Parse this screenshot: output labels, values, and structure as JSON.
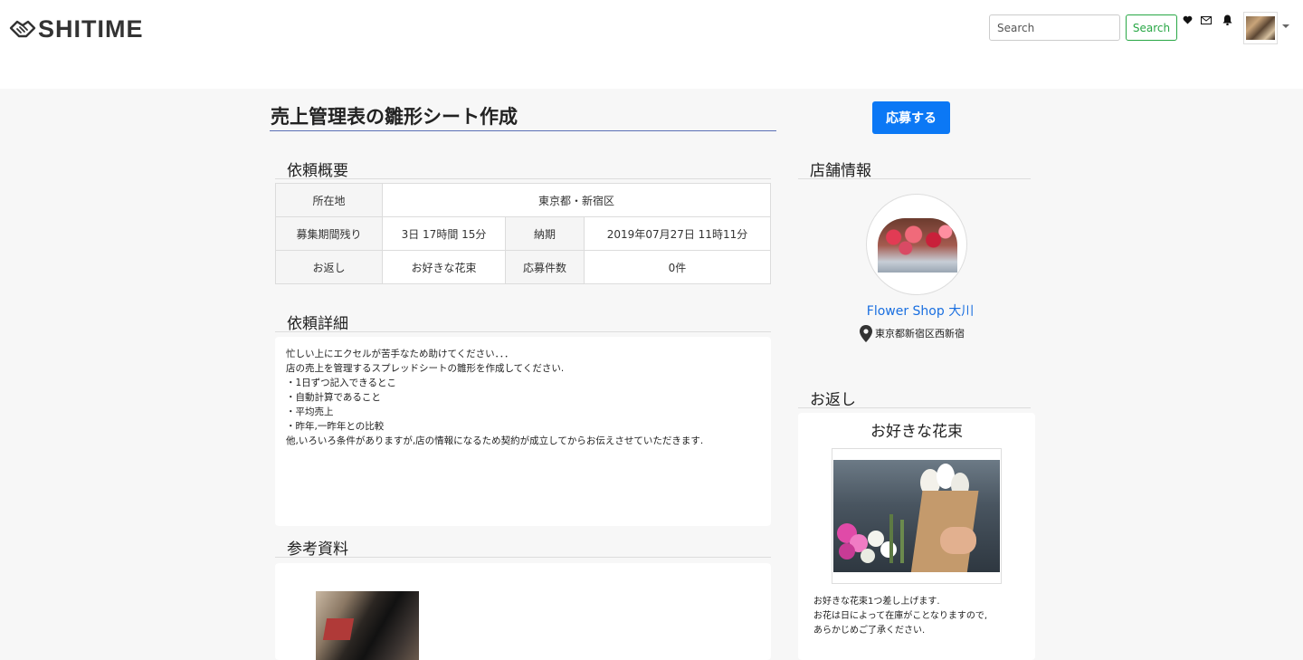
{
  "header": {
    "logo_text": "SHITIME",
    "search_placeholder": "Search",
    "search_button": "Search",
    "icons": [
      "heart-icon",
      "mail-icon",
      "bell-icon"
    ]
  },
  "job": {
    "title": "売上管理表の雛形シート作成",
    "apply_button": "応募する"
  },
  "overview": {
    "heading": "依頼概要",
    "location_label": "所在地",
    "location_value": "東京都・新宿区",
    "period_label": "募集期間残り",
    "period_value": "3日 17時間 15分",
    "deadline_label": "納期",
    "deadline_value": "2019年07月27日 11時11分",
    "reward_label": "お返し",
    "reward_value": "お好きな花束",
    "applicants_label": "応募件数",
    "applicants_value": "0件"
  },
  "details": {
    "heading": "依頼詳細",
    "lines": [
      "忙しい上にエクセルが苦手なため助けてください．．．",
      "",
      "店の売上を管理するスプレッドシートの雛形を作成してください.",
      "",
      "",
      "・1日ずつ記入できるとこ",
      "・自動計算であること",
      "・平均売上",
      "・昨年,一昨年との比較",
      "",
      "他,いろいろ条件がありますが,店の情報になるため契約が成立してからお伝えさせていただきます."
    ]
  },
  "references": {
    "heading": "参考資料"
  },
  "shop": {
    "heading": "店舗情報",
    "name": "Flower Shop 大川",
    "address": "東京都新宿区西新宿"
  },
  "gift": {
    "heading": "お返し",
    "name": "お好きな花束",
    "lines": [
      "お好きな花束1つ差し上げます.",
      "",
      "お花は日によって在庫がことなりますので,",
      "あらかじめご了承ください."
    ]
  },
  "colors": {
    "accent_blue": "#0b78f5",
    "link_blue": "#1a6fe0",
    "search_green": "#28a745"
  }
}
